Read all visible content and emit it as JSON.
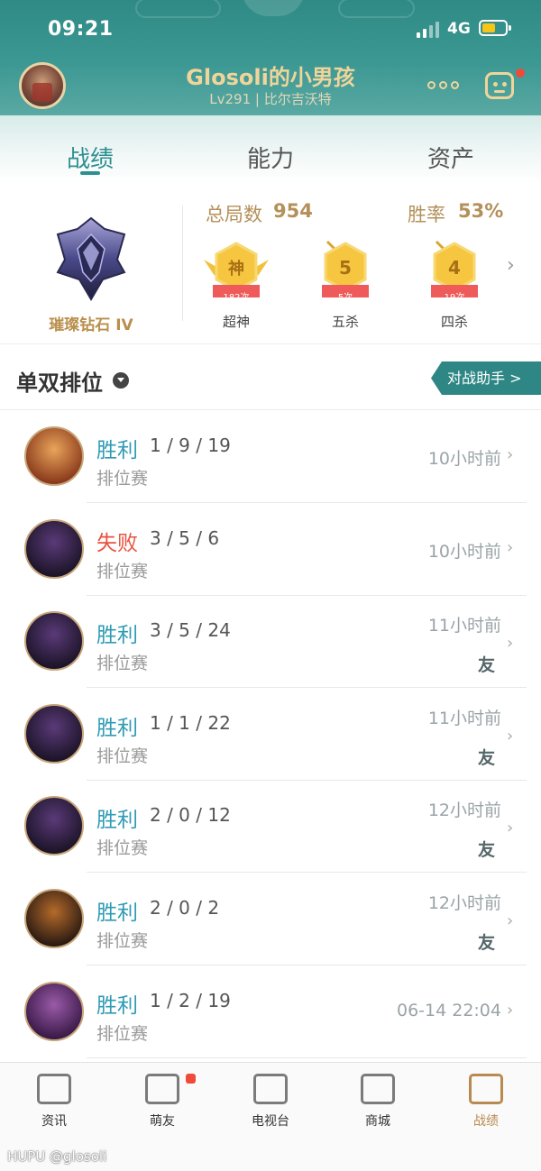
{
  "status_bar": {
    "time": "09:21",
    "network": "4G",
    "battery_level": 0.6
  },
  "header": {
    "player_name": "Glosoli的小男孩",
    "level_server": "Lv291 | 比尔吉沃特",
    "accent_color": "#f0d49a",
    "bg_color": "#3c9893"
  },
  "tabs": [
    "战绩",
    "能力",
    "资产"
  ],
  "summary": {
    "rank": "璀璨钻石 IV",
    "total_games_label": "总局数",
    "total_games": "954",
    "winrate_label": "胜率",
    "winrate": "53%",
    "badges": [
      {
        "icon": "神",
        "count": "182次",
        "label": "超神"
      },
      {
        "icon": "5",
        "count": "5次",
        "label": "五杀"
      },
      {
        "icon": "4",
        "count": "19次",
        "label": "四杀"
      }
    ]
  },
  "queue": {
    "title": "单双排位",
    "assist_button": "对战助手 >"
  },
  "matches": [
    {
      "result": "胜利",
      "kda": "1 / 9 / 19",
      "mode": "排位赛",
      "time": "10小时前",
      "friend": "",
      "champion_icon": "champion-portrait-icon"
    },
    {
      "result": "失败",
      "kda": "3 / 5 / 6",
      "mode": "排位赛",
      "time": "10小时前",
      "friend": "",
      "champion_icon": "champion-portrait-icon"
    },
    {
      "result": "胜利",
      "kda": "3 / 5 / 24",
      "mode": "排位赛",
      "time": "11小时前",
      "friend": "友",
      "champion_icon": "champion-portrait-icon"
    },
    {
      "result": "胜利",
      "kda": "1 / 1 / 22",
      "mode": "排位赛",
      "time": "11小时前",
      "friend": "友",
      "champion_icon": "champion-portrait-icon"
    },
    {
      "result": "胜利",
      "kda": "2 / 0 / 12",
      "mode": "排位赛",
      "time": "12小时前",
      "friend": "友",
      "champion_icon": "champion-portrait-icon"
    },
    {
      "result": "胜利",
      "kda": "2 / 0 / 2",
      "mode": "排位赛",
      "time": "12小时前",
      "friend": "友",
      "champion_icon": "champion-portrait-icon"
    },
    {
      "result": "胜利",
      "kda": "1 / 2 / 19",
      "mode": "排位赛",
      "time": "06-14 22:04",
      "friend": "",
      "champion_icon": "champion-portrait-icon"
    }
  ],
  "bottom_nav": [
    {
      "label": "资讯",
      "icon": "news-icon"
    },
    {
      "label": "萌友",
      "icon": "friends-icon"
    },
    {
      "label": "电视台",
      "icon": "tv-icon"
    },
    {
      "label": "商城",
      "icon": "shop-icon"
    },
    {
      "label": "战绩",
      "icon": "record-icon"
    }
  ],
  "watermark": "HUPU @glosoli"
}
